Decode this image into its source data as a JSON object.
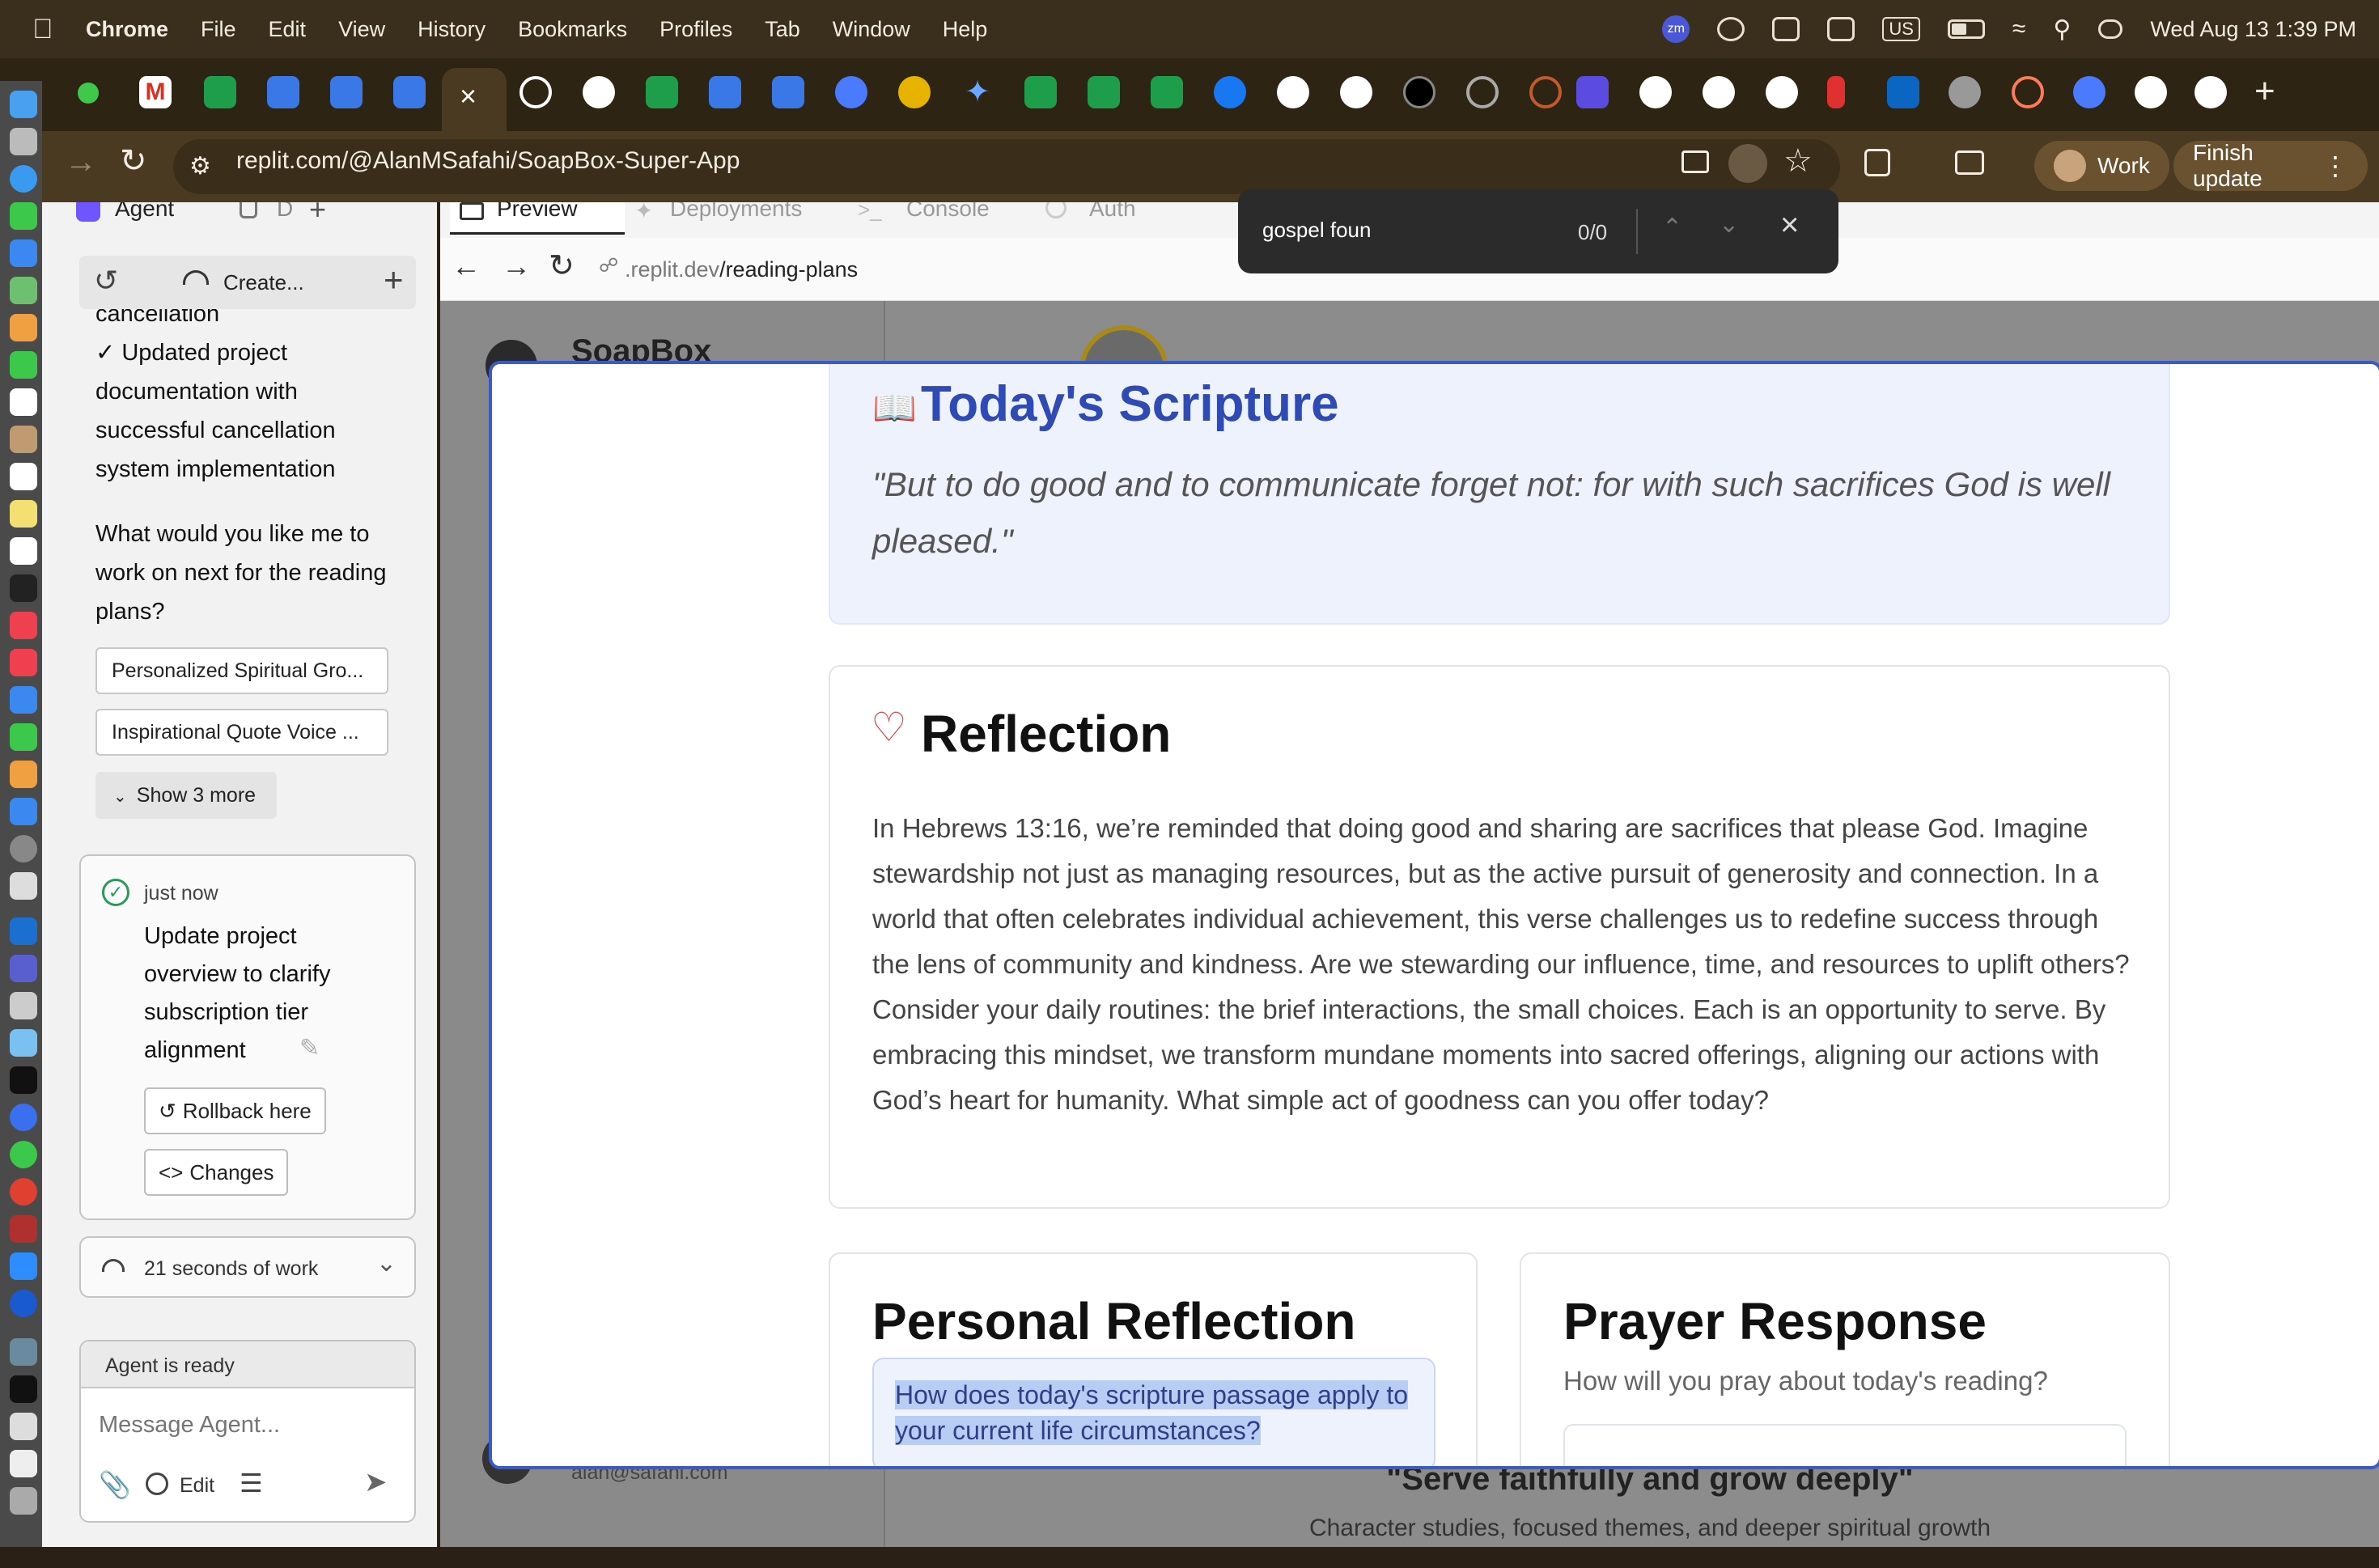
{
  "menubar": {
    "app_name": "Chrome",
    "menus": [
      "File",
      "Edit",
      "View",
      "History",
      "Bookmarks",
      "Profiles",
      "Tab",
      "Window",
      "Help"
    ],
    "keyboard": "US",
    "datetime": "Wed Aug 13  1:39 PM",
    "zoom_badge": "zm"
  },
  "browser": {
    "url": "replit.com/@AlanMSafahi/SoapBox-Super-App",
    "profile_label": "Work",
    "update_label": "Finish update"
  },
  "find_bar": {
    "query": "gospel foun",
    "count": "0/0"
  },
  "sidebar": {
    "agent_tab": "Agent",
    "db_tab": "D",
    "create_label": "Create...",
    "chat": {
      "fragment_line": "cancellation",
      "checked_item": "✓ Updated project documentation with successful cancellation system implementation",
      "question": "What would you like me to work on next for the reading plans?",
      "suggestions": [
        "Personalized Spiritual Gro...",
        "Inspirational Quote Voice ..."
      ],
      "show_more": "Show 3 more"
    },
    "checkpoint": {
      "time": "just now",
      "title": "Update project overview to clarify subscription tier alignment",
      "rollback_label": "Rollback here",
      "changes_label": "Changes"
    },
    "work_summary": "21 seconds of work",
    "agent_status": "Agent is ready",
    "message_placeholder": "Message Agent...",
    "edit_label": "Edit"
  },
  "panel_tabs": [
    "Preview",
    "Deployments",
    "Console",
    "Auth"
  ],
  "preview": {
    "url_dim": ".replit.dev",
    "url_path": "/reading-plans",
    "bg_app_title": "SoapBox",
    "bg_email": "alan@safahi.com",
    "bg_tagline": "\"Serve faithfully and grow deeply\"",
    "bg_subtitle": "Character studies, focused themes, and deeper spiritual growth"
  },
  "modal": {
    "scripture_heading": "Today's Scripture",
    "scripture_quote": "\"But to do good and to communicate forget not: for with such sacrifices God is well pleased.\"",
    "reflection_heading": "Reflection",
    "reflection_body": "In Hebrews 13:16, we’re reminded that doing good and sharing are sacrifices that please God. Imagine stewardship not just as managing resources, but as the active pursuit of generosity and connection. In a world that often celebrates individual achievement, this verse challenges us to redefine success through the lens of community and kindness. Are we stewarding our influence, time, and resources to uplift others? Consider your daily routines: the brief interactions, the small choices. Each is an opportunity to serve. By embracing this mindset, we transform mundane moments into sacred offerings, aligning our actions with God’s heart for humanity. What simple act of goodness can you offer today?",
    "personal_heading": "Personal Reflection",
    "personal_prompt": "How does today's scripture passage apply to your current life circumstances?",
    "prayer_heading": "Prayer Response",
    "prayer_subtitle": "How will you pray about today's reading?"
  },
  "colors": {
    "accent_blue": "#2f4ab4",
    "heart_red": "#e04848",
    "scripture_bg": "#eef2fc"
  }
}
